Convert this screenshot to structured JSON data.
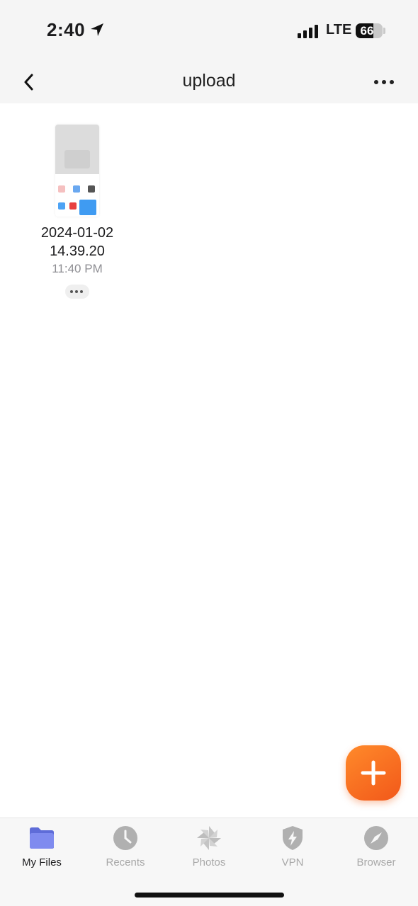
{
  "status_bar": {
    "time": "2:40",
    "carrier": "LTE",
    "battery_level": "66",
    "battery_fraction": 0.66
  },
  "nav": {
    "title": "upload",
    "back_icon": "chevron-left-icon",
    "more_icon": "ellipsis-icon"
  },
  "files": [
    {
      "name": "2024-01-02 14.39.20",
      "time": "11:40 PM",
      "thumbnail_icon": "screenshot-thumbnail"
    }
  ],
  "fab": {
    "icon": "plus-icon",
    "color": "#f36a1f"
  },
  "tabs": [
    {
      "label": "My Files",
      "icon": "folder-icon",
      "active": true
    },
    {
      "label": "Recents",
      "icon": "clock-icon",
      "active": false
    },
    {
      "label": "Photos",
      "icon": "pinwheel-icon",
      "active": false
    },
    {
      "label": "VPN",
      "icon": "shield-bolt-icon",
      "active": false
    },
    {
      "label": "Browser",
      "icon": "compass-icon",
      "active": false
    }
  ],
  "colors": {
    "accent": "#f36a1f",
    "folder": "#6b79e6",
    "inactive": "#a8a8a8"
  }
}
